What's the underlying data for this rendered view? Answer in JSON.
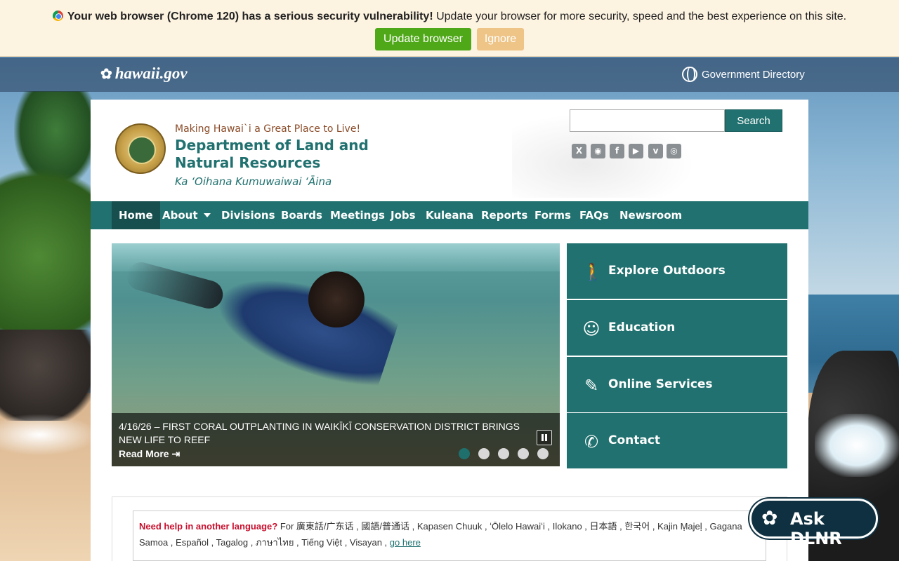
{
  "banner": {
    "bold": "Your web browser (Chrome 120) has a serious security vulnerability!",
    "rest": " Update your browser for more security, speed and the best experience on this site.",
    "update_label": "Update browser",
    "ignore_label": "Ignore"
  },
  "govbar": {
    "logo": "hawaii.gov",
    "directory": "Government Directory"
  },
  "header": {
    "tagline": "Making Hawai`i a Great Place to Live!",
    "department": "Department of Land and Natural Resources",
    "hawaiian_name": "Ka ʻOihana Kumuwaiwai ʻĀina",
    "search_button": "Search",
    "social": [
      {
        "icon": "x-icon",
        "glyph": "X"
      },
      {
        "icon": "rss-icon",
        "glyph": "◉"
      },
      {
        "icon": "facebook-icon",
        "glyph": "f"
      },
      {
        "icon": "youtube-icon",
        "glyph": "▶"
      },
      {
        "icon": "vimeo-icon",
        "glyph": "v"
      },
      {
        "icon": "instagram-icon",
        "glyph": "◎"
      }
    ]
  },
  "nav": {
    "items": [
      "Home",
      "About",
      "Divisions",
      "Boards",
      "Meetings",
      "Jobs",
      "Kuleana",
      "Reports",
      "Forms",
      "FAQs",
      "Newsroom"
    ]
  },
  "slideshow": {
    "caption": "4/16/26 – First Coral Outplanting in Waikīkī Conservation District Brings New Life to Reef",
    "read_more": "Read More",
    "active_dot": 1,
    "dot_count": 5
  },
  "tiles": [
    {
      "label": "Explore Outdoors",
      "icon": "hiker-icon",
      "glyph": "🚶"
    },
    {
      "label": "Education",
      "icon": "student-icon",
      "glyph": "☺"
    },
    {
      "label": "Online Services",
      "icon": "computer-user-icon",
      "glyph": "✎"
    },
    {
      "label": "Contact",
      "icon": "phone-icon",
      "glyph": "✆"
    }
  ],
  "language": {
    "need_help": "Need help in another language?",
    "list": " For 廣東話/广东话 , 國語/普通话 , Kapasen Chuuk , ʻŌlelo Hawaiʻi , Ilokano , 日本語 , 한국어 , Kajin Ṃajeḷ , Gagana Samoa , Español , Tagalog , ภาษาไทย , Tiếng Việt , Visayan , ",
    "go_here": "go here"
  },
  "ask": {
    "label": "Ask DLNR"
  },
  "colors": {
    "teal": "#20716f",
    "teal_dark": "#174f4e",
    "update_green": "#4fa818",
    "ignore_tan": "#eec487"
  }
}
